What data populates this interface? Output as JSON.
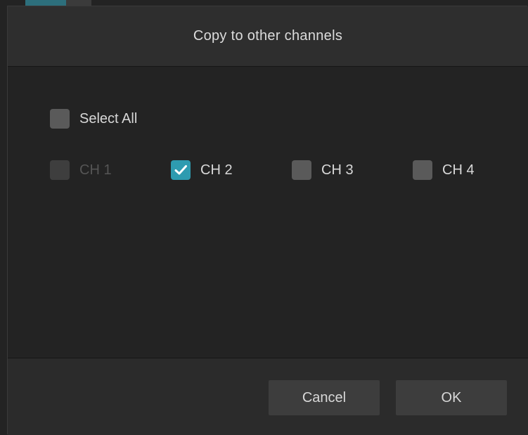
{
  "dialog": {
    "title": "Copy to other channels"
  },
  "select_all": {
    "label": "Select All",
    "checked": false
  },
  "channels": [
    {
      "label": "CH 1",
      "checked": false,
      "disabled": true
    },
    {
      "label": "CH 2",
      "checked": true,
      "disabled": false
    },
    {
      "label": "CH 3",
      "checked": false,
      "disabled": false
    },
    {
      "label": "CH 4",
      "checked": false,
      "disabled": false
    }
  ],
  "footer": {
    "cancel_label": "Cancel",
    "ok_label": "OK"
  },
  "colors": {
    "accent": "#2e9bb0",
    "checkbox_unchecked": "#5a5a5a",
    "checkbox_disabled": "#3e3e3e",
    "background": "#232323"
  },
  "icons": {
    "check": "check-icon"
  }
}
